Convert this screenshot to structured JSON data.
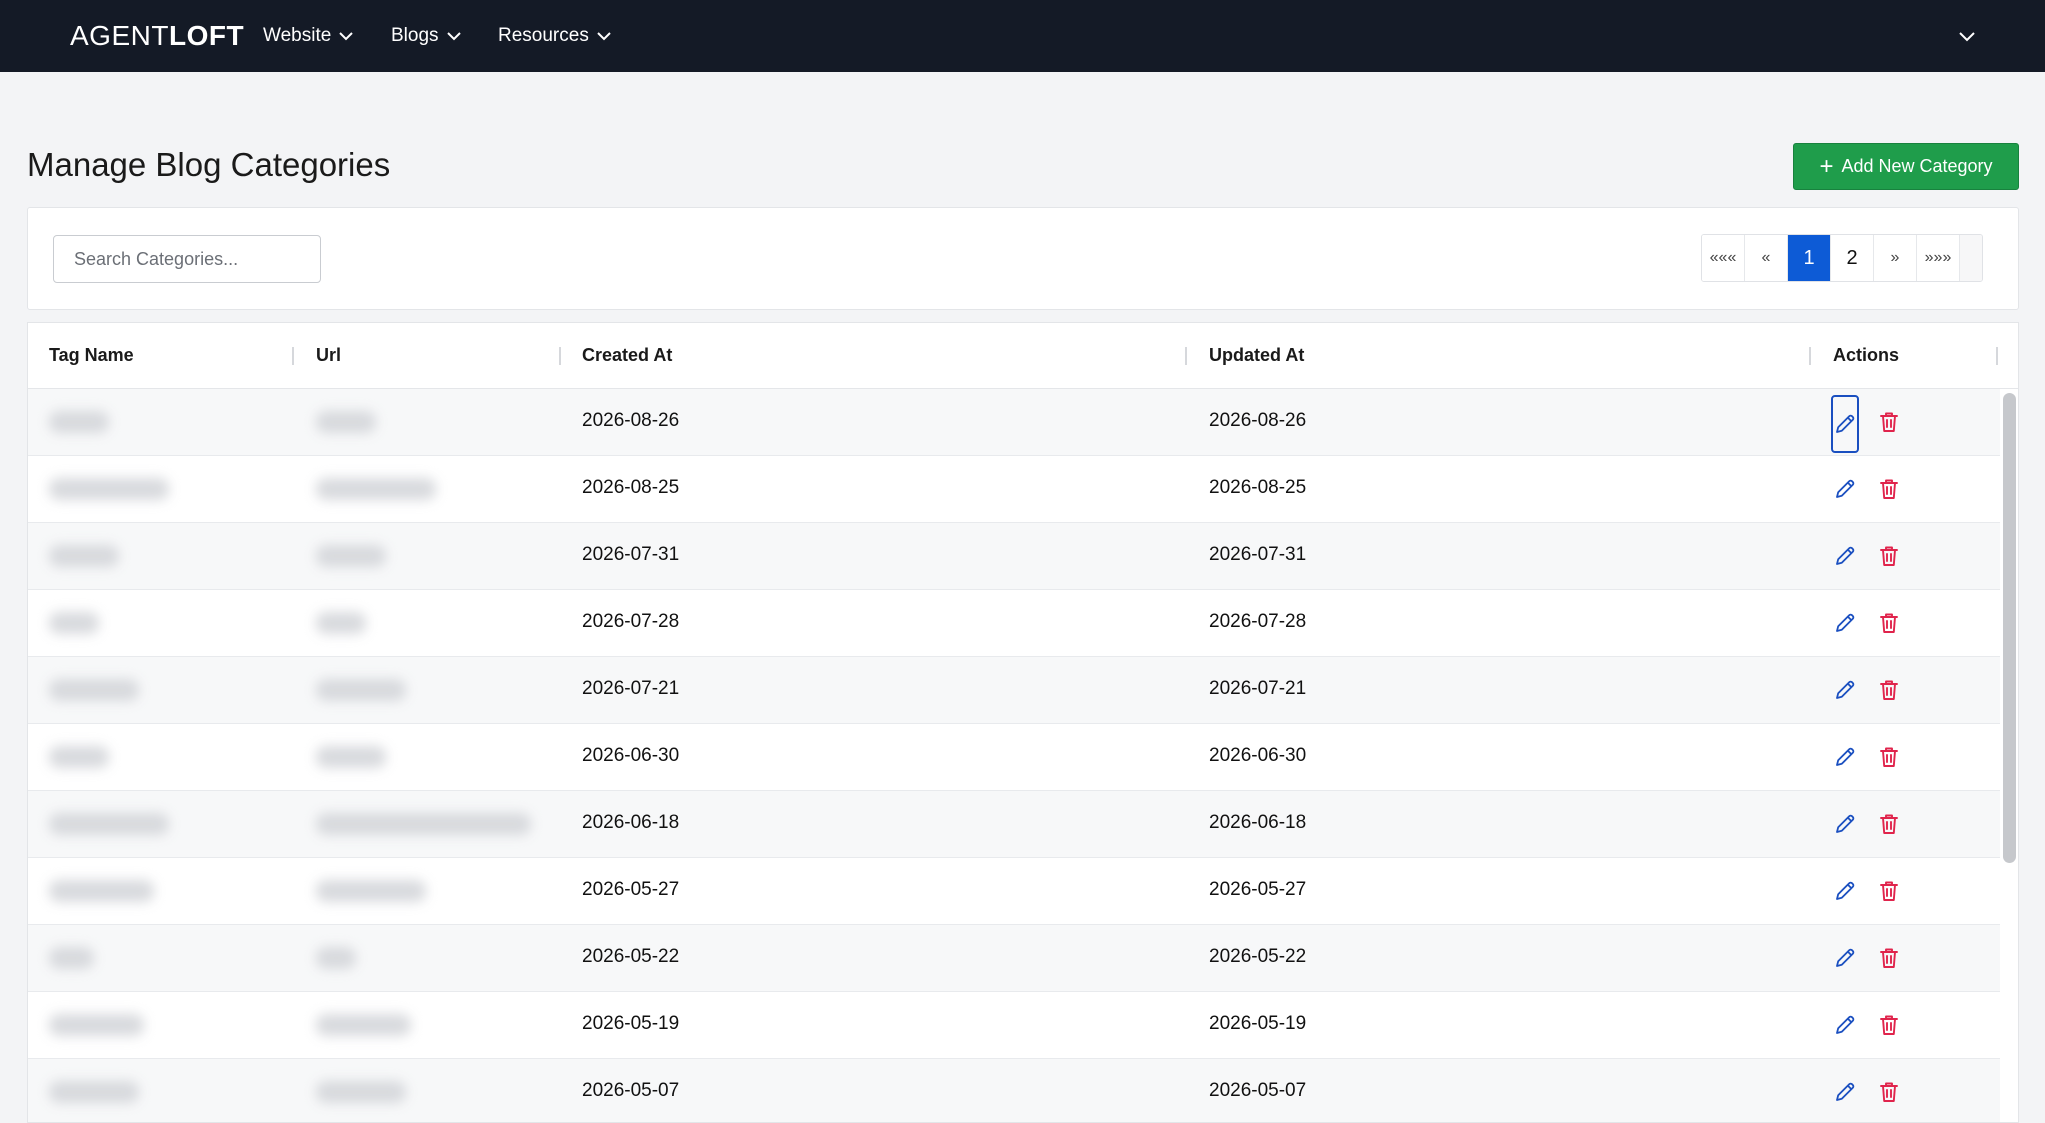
{
  "header": {
    "brand_light": "AGENT",
    "brand_bold": "LOFT",
    "nav": [
      {
        "label": "Website"
      },
      {
        "label": "Blogs"
      },
      {
        "label": "Resources"
      }
    ]
  },
  "page": {
    "title": "Manage Blog Categories",
    "add_button_label": "Add New Category"
  },
  "search": {
    "placeholder": "Search Categories..."
  },
  "pagination": {
    "first": "«««",
    "prev": "«",
    "pages": [
      "1",
      "2"
    ],
    "current": "1",
    "next": "»",
    "last": "»»»"
  },
  "table": {
    "columns": [
      "Tag Name",
      "Url",
      "Created At",
      "Updated At",
      "Actions"
    ],
    "rows": [
      {
        "created_at": "2026-08-26",
        "updated_at": "2026-08-26"
      },
      {
        "created_at": "2026-08-25",
        "updated_at": "2026-08-25"
      },
      {
        "created_at": "2026-07-31",
        "updated_at": "2026-07-31"
      },
      {
        "created_at": "2026-07-28",
        "updated_at": "2026-07-28"
      },
      {
        "created_at": "2026-07-21",
        "updated_at": "2026-07-21"
      },
      {
        "created_at": "2026-06-30",
        "updated_at": "2026-06-30"
      },
      {
        "created_at": "2026-06-18",
        "updated_at": "2026-06-18"
      },
      {
        "created_at": "2026-05-27",
        "updated_at": "2026-05-27"
      },
      {
        "created_at": "2026-05-22",
        "updated_at": "2026-05-22"
      },
      {
        "created_at": "2026-05-19",
        "updated_at": "2026-05-19"
      },
      {
        "created_at": "2026-05-07",
        "updated_at": "2026-05-07"
      }
    ]
  },
  "icons": {
    "edit": "pencil-icon",
    "delete": "trash-icon",
    "nav_chevron": "chevron-down-icon",
    "add": "plus-icon"
  },
  "colors": {
    "topbar": "#141a26",
    "primary": "#0d5bd6",
    "success": "#1f9d4b",
    "danger": "#e0244c",
    "edit_icon": "#1a4fc0"
  }
}
